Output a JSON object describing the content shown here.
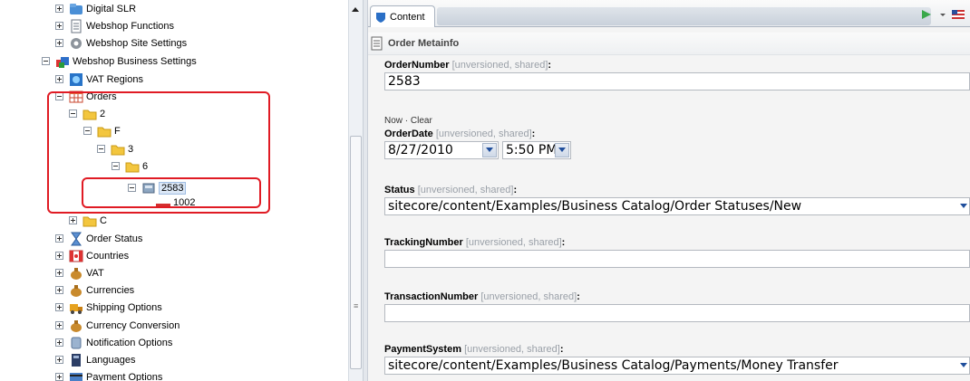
{
  "tree": {
    "items": [
      {
        "label": "Digital SLR"
      },
      {
        "label": "Webshop Functions"
      },
      {
        "label": "Webshop Site Settings"
      },
      {
        "label": "Webshop Business Settings"
      },
      {
        "label": "VAT Regions"
      },
      {
        "label": "Orders"
      },
      {
        "label": "2"
      },
      {
        "label": "F"
      },
      {
        "label": "3"
      },
      {
        "label": "6"
      },
      {
        "label": "2583"
      },
      {
        "label": "1002"
      },
      {
        "label": "C"
      },
      {
        "label": "Order Status"
      },
      {
        "label": "Countries"
      },
      {
        "label": "VAT"
      },
      {
        "label": "Currencies"
      },
      {
        "label": "Shipping Options"
      },
      {
        "label": "Currency Conversion"
      },
      {
        "label": "Notification Options"
      },
      {
        "label": "Languages"
      },
      {
        "label": "Payment Options"
      }
    ]
  },
  "content": {
    "tab_label": "Content",
    "section_title": "Order Metainfo",
    "meta_suffix": "[unversioned, shared]",
    "date_links": {
      "now": "Now",
      "sep": "·",
      "clear": "Clear"
    },
    "fields": {
      "order_number": {
        "label": "OrderNumber",
        "value": "2583"
      },
      "order_date": {
        "label": "OrderDate",
        "date": "8/27/2010",
        "time": "5:50 PM"
      },
      "status": {
        "label": "Status",
        "value": "sitecore/content/Examples/Business Catalog/Order Statuses/New"
      },
      "tracking_number": {
        "label": "TrackingNumber",
        "value": ""
      },
      "transaction_number": {
        "label": "TransactionNumber",
        "value": ""
      },
      "payment_system": {
        "label": "PaymentSystem",
        "value": "sitecore/content/Examples/Business Catalog/Payments/Money Transfer"
      }
    }
  },
  "colors": {
    "highlight": "#e01b24",
    "selection": "#dbe7f6"
  }
}
